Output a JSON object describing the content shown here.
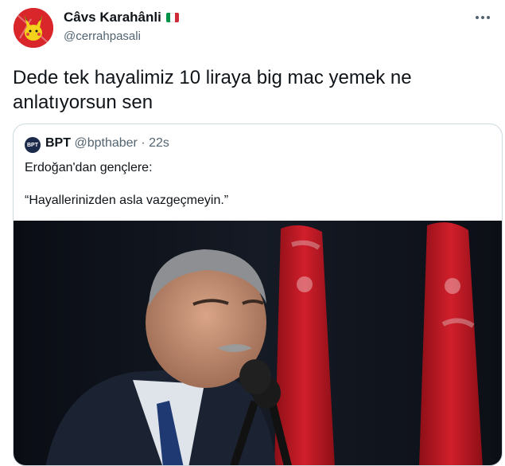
{
  "author": {
    "display_name": "Câvs Karahânli",
    "handle": "@cerrahpasali",
    "flag_colors": [
      "#009246",
      "#ffffff",
      "#ce2b37"
    ]
  },
  "tweet": {
    "text": "Dede tek hayalimiz 10 liraya big mac yemek ne anlatıyorsun sen"
  },
  "menu": {
    "icon": "more-horizontal-icon"
  },
  "quoted_tweet": {
    "avatar_text": "BPT",
    "display_name": "BPT",
    "handle": "@bpthaber",
    "separator": "·",
    "time": "22s",
    "line1": "Erdoğan'dan gençlere:",
    "line2": "“Hayallerinizden asla vazgeçmeyin.”"
  },
  "colors": {
    "avatar_red": "#d8262b",
    "flag_red": "#c8102e",
    "text_secondary": "#536471",
    "border": "#cfd9de"
  }
}
